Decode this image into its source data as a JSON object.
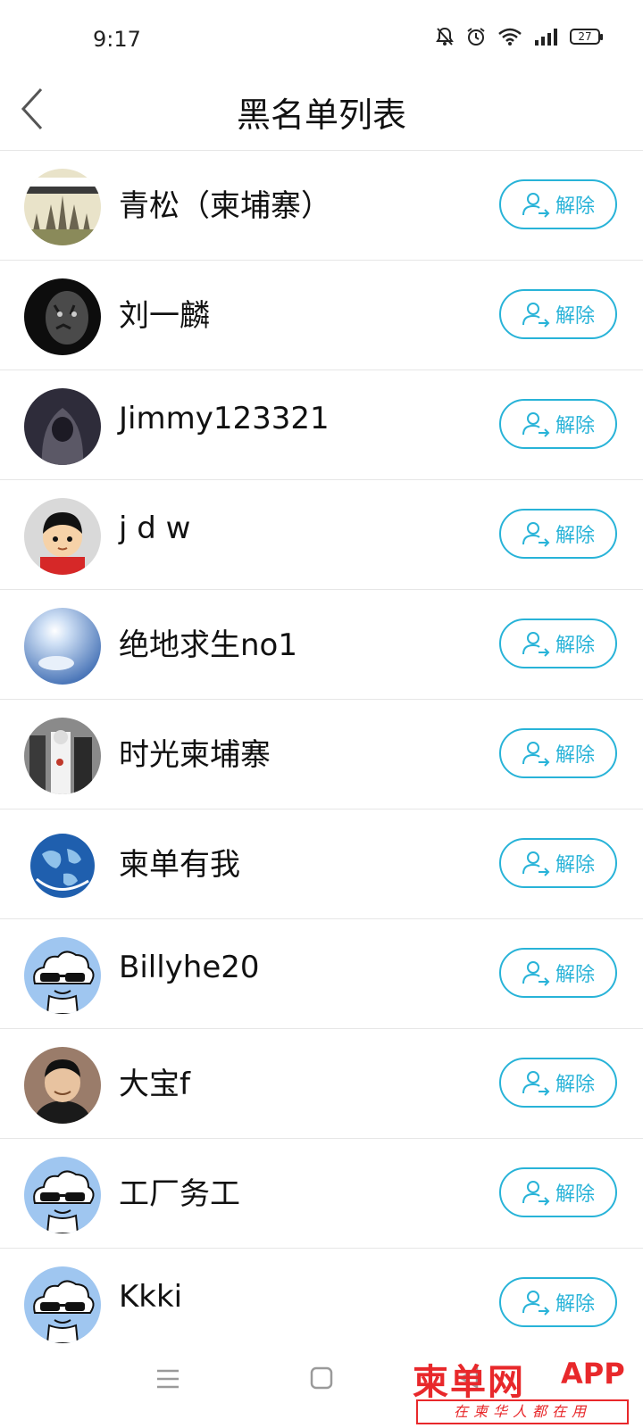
{
  "status_bar": {
    "time": "9:17",
    "battery": "27"
  },
  "header": {
    "title": "黑名单列表"
  },
  "unblock_label": "解除",
  "blocked_users": [
    {
      "name": "青松（柬埔寨）",
      "avatar": "angkor-wat-avatar"
    },
    {
      "name": "刘一麟",
      "avatar": "tiger-avatar"
    },
    {
      "name": "Jimmy123321",
      "avatar": "hooded-figure-avatar"
    },
    {
      "name": "j d w",
      "avatar": "cartoon-boy-avatar"
    },
    {
      "name": "绝地求生no1",
      "avatar": "sky-sun-avatar"
    },
    {
      "name": "时光柬埔寨",
      "avatar": "people-photo-avatar"
    },
    {
      "name": "柬单有我",
      "avatar": "globe-avatar"
    },
    {
      "name": "Billyhe20",
      "avatar": "default-cloud-avatar"
    },
    {
      "name": "大宝f",
      "avatar": "portrait-avatar"
    },
    {
      "name": "工厂务工",
      "avatar": "default-cloud-avatar"
    },
    {
      "name": "Kkki",
      "avatar": "default-cloud-avatar"
    }
  ],
  "watermark": {
    "main": "柬单网",
    "app": "APP",
    "sub": "在柬华人都在用"
  },
  "colors": {
    "accent": "#28b3d8",
    "divider": "#e6e6e6",
    "watermark": "#e8282b"
  }
}
